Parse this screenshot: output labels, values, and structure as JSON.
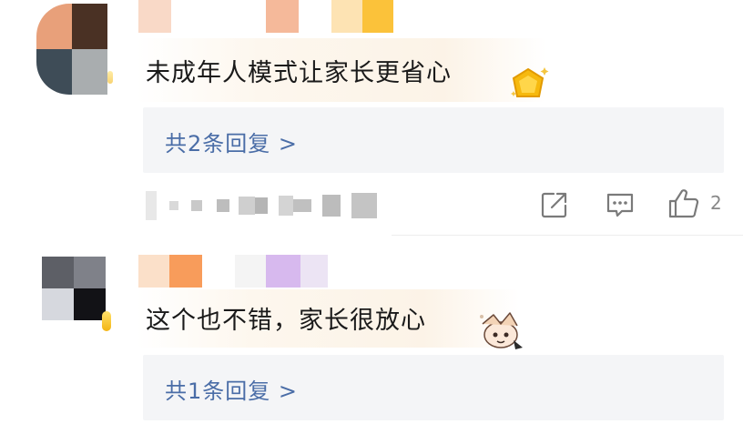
{
  "comments": [
    {
      "text": "未成年人模式让家长更省心",
      "reply_link": "共2条回复 >",
      "likes": "2",
      "icons": {
        "share": "share-icon",
        "comment": "comment-icon",
        "like": "thumbs-up-icon"
      },
      "badge_icon": "gold-shield-badge-icon"
    },
    {
      "text": "这个也不错，家长很放心",
      "reply_link": "共1条回复 >",
      "badge_icon": "anime-sticker-icon"
    }
  ],
  "colors": {
    "link": "#4a6da7",
    "text": "#1a1a1a",
    "reply_bg": "#f4f5f7",
    "meta": "#888888"
  }
}
